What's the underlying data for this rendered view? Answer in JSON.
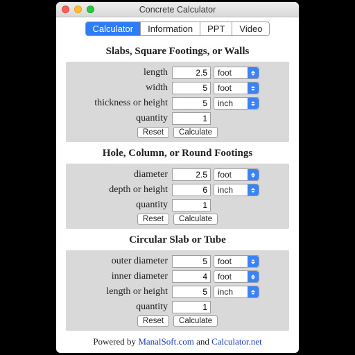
{
  "window": {
    "title": "Concrete Calculator"
  },
  "tabs": [
    "Calculator",
    "Information",
    "PPT",
    "Video"
  ],
  "sections": {
    "slab": {
      "title": "Slabs, Square Footings, or Walls",
      "rows": {
        "length": {
          "label": "length",
          "value": "2.5",
          "unit": "foot"
        },
        "width": {
          "label": "width",
          "value": "5",
          "unit": "foot"
        },
        "thick": {
          "label": "thickness or height",
          "value": "5",
          "unit": "inch"
        },
        "qty": {
          "label": "quantity",
          "value": "1"
        }
      }
    },
    "hole": {
      "title": "Hole, Column, or Round Footings",
      "rows": {
        "dia": {
          "label": "diameter",
          "value": "2.5",
          "unit": "foot"
        },
        "depth": {
          "label": "depth or height",
          "value": "6",
          "unit": "inch"
        },
        "qty": {
          "label": "quantity",
          "value": "1"
        }
      }
    },
    "tube": {
      "title": "Circular Slab or Tube",
      "rows": {
        "outer": {
          "label": "outer diameter",
          "value": "5",
          "unit": "foot"
        },
        "inner": {
          "label": "inner diameter",
          "value": "4",
          "unit": "foot"
        },
        "len": {
          "label": "length or height",
          "value": "5",
          "unit": "inch"
        },
        "qty": {
          "label": "quantity",
          "value": "1"
        }
      }
    }
  },
  "buttons": {
    "reset": "Reset",
    "calc": "Calculate"
  },
  "footer": {
    "prefix": "Powered by ",
    "link1": "ManalSoft.com",
    "sep": " and ",
    "link2": "Calculator.net"
  }
}
